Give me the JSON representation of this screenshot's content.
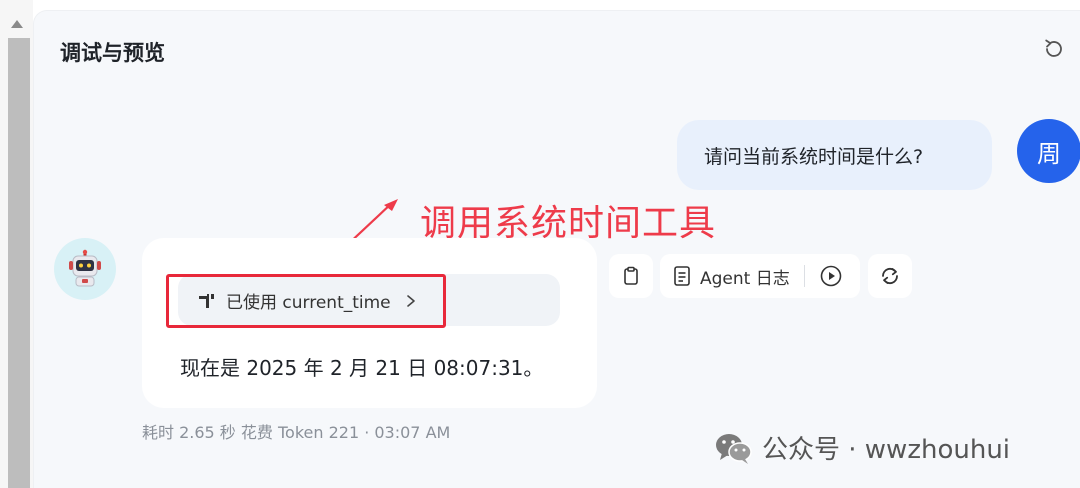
{
  "panel": {
    "title": "调试与预览"
  },
  "user_message": {
    "text": "请问当前系统时间是什么?",
    "avatar_text": "周"
  },
  "annotation": {
    "text": "调用系统时间工具"
  },
  "bot_message": {
    "tool_used_label": "已使用 current_time",
    "answer": "现在是 2025 年 2 月 21 日 08:07:31。"
  },
  "actions": {
    "agent_log_label": "Agent 日志"
  },
  "meta": {
    "text": "耗时 2.65 秒  花费 Token 221  ·  03:07 AM"
  },
  "watermark": {
    "text": "公众号 · wwzhouhui"
  },
  "colors": {
    "accent": "#2563eb",
    "annotation": "#ee3b4a",
    "user_bubble": "#e8f0fc"
  },
  "icons": {
    "refresh": "refresh-icon",
    "tool": "tool-icon",
    "copy": "clipboard-icon",
    "log": "log-icon",
    "play": "play-icon",
    "regenerate": "regenerate-icon"
  }
}
